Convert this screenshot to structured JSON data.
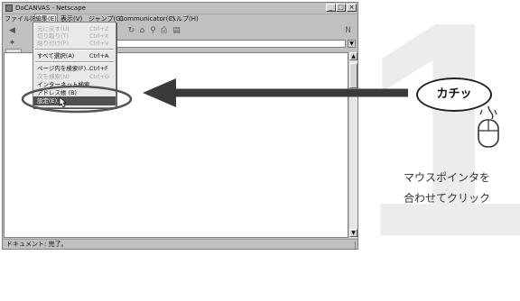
{
  "window": {
    "title": "DoCANVAS - Netscape",
    "controls": [
      "_",
      "□",
      "×"
    ]
  },
  "menubar": {
    "items": [
      "ファイル(F)",
      "編集(E)",
      "表示(V)",
      "ジャンプ(G)",
      "Communicator(C)",
      "ヘルプ(H)"
    ],
    "active_index": 1
  },
  "dropdown": {
    "items": [
      {
        "label": "元に戻す(U)",
        "shortcut": "Ctrl+Z",
        "disabled": true
      },
      {
        "label": "切り取り(T)",
        "shortcut": "Ctrl+X",
        "disabled": true
      },
      {
        "label": "貼り付け(P)",
        "shortcut": "Ctrl+V",
        "disabled": true
      },
      {
        "label": "すべて選択(A)",
        "shortcut": "Ctrl+A",
        "disabled": false
      },
      {
        "label": "ページ内を検索(F)...",
        "shortcut": "Ctrl+F",
        "disabled": false
      },
      {
        "label": "次を検索(N)",
        "shortcut": "Ctrl+G",
        "disabled": true
      },
      {
        "label": "インターネット検索",
        "shortcut": "",
        "disabled": false
      },
      {
        "label": "アドレス帳 (B)",
        "shortcut": "",
        "disabled": false
      },
      {
        "label": "設定(E)...",
        "shortcut": "",
        "disabled": false,
        "selected": true
      }
    ]
  },
  "statusbar": {
    "text": "ドキュメント: 完了。"
  },
  "annotation": {
    "step_number": "1",
    "callout_text": "カチッ",
    "caption_line1": "マウスポインタを",
    "caption_line2": "合わせてクリック",
    "accent_color": "#3a3a3a"
  }
}
